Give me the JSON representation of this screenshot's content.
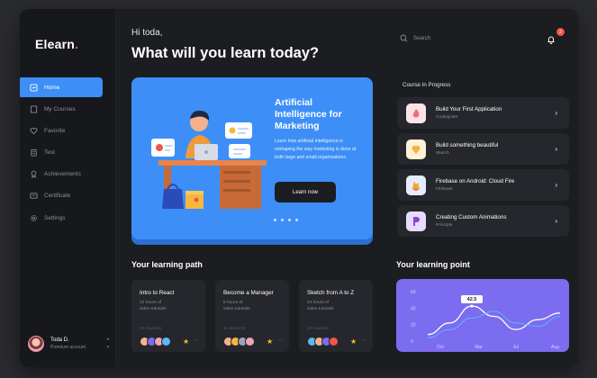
{
  "brand": {
    "name": "Elearn",
    "dot": "."
  },
  "sidebar": {
    "items": [
      {
        "label": "Home",
        "icon": "home-icon",
        "active": true
      },
      {
        "label": "My Courses",
        "icon": "book-icon",
        "active": false
      },
      {
        "label": "Favorite",
        "icon": "heart-icon",
        "active": false
      },
      {
        "label": "Test",
        "icon": "clipboard-icon",
        "active": false
      },
      {
        "label": "Achievements",
        "icon": "trophy-icon",
        "active": false
      },
      {
        "label": "Certificate",
        "icon": "certificate-icon",
        "active": false
      },
      {
        "label": "Settings",
        "icon": "gear-icon",
        "active": false
      }
    ],
    "user": {
      "name": "Toda D.",
      "role": "Premium account"
    }
  },
  "header": {
    "greeting": "Hi toda,",
    "title": "What will you learn today?",
    "search_placeholder": "Search",
    "notifications": "2"
  },
  "hero": {
    "title": "Artificial Intelligence for Marketing",
    "description": "Learn how artificial intelligence is reshaping the way marketing is done at both large and small organizations.",
    "button": "Learn now"
  },
  "courses_in_progress": {
    "title": "Course In Progress",
    "items": [
      {
        "title": "Build Your First Application",
        "subtitle": "Codeigniter",
        "color": "#f46b7f",
        "bg": "#fbe4e8"
      },
      {
        "title": "Build something beautiful",
        "subtitle": "Sketch",
        "color": "#f5b23d",
        "bg": "#fff1d6"
      },
      {
        "title": "Firebase on Android: Cloud Fire",
        "subtitle": "Firebase",
        "color": "#f5a623",
        "bg": "#e4ecff"
      },
      {
        "title": "Creating Custom Animations",
        "subtitle": "Principle",
        "color": "#8e44c9",
        "bg": "#e7dcff"
      }
    ]
  },
  "learning_path": {
    "title": "Your learning path",
    "cards": [
      {
        "title": "Intro to React",
        "hours": "12 hours of",
        "sub": "video tutorials",
        "enrolled": "4K students"
      },
      {
        "title": "Become a Manager",
        "hours": "8 hours of",
        "sub": "video tutorials",
        "enrolled": "6K students"
      },
      {
        "title": "Sketch from A to Z",
        "hours": "24 hours of",
        "sub": "video tutorials",
        "enrolled": "2K students"
      }
    ]
  },
  "learning_point": {
    "title": "Your learning point"
  },
  "chart_data": {
    "type": "line",
    "x": [
      "Oct",
      "Mar",
      "Jul",
      "Aug"
    ],
    "yticks": [
      0,
      20,
      40,
      60
    ],
    "ylim": [
      0,
      60
    ],
    "tooltip": "42.5",
    "series": [
      {
        "values": [
          8,
          22,
          42.5,
          30,
          14,
          26,
          34
        ],
        "color": "#ffffff"
      },
      {
        "values": [
          4,
          14,
          28,
          36,
          22,
          18,
          30
        ],
        "color": "#5bb8f5"
      }
    ]
  }
}
